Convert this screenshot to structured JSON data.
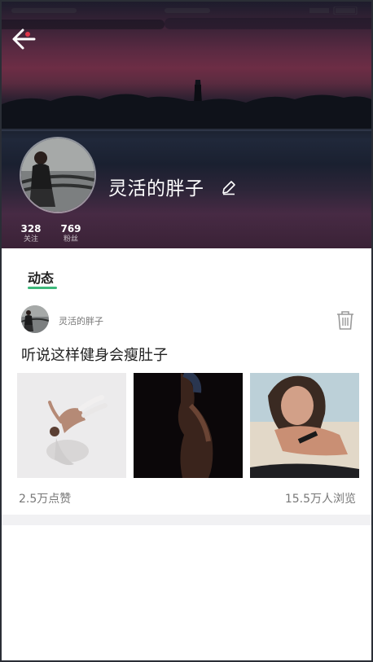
{
  "header": {
    "back_icon": "arrow-left-icon",
    "username": "灵活的胖子",
    "edit_icon": "pencil-icon",
    "stats": [
      {
        "value": "328",
        "label": "关注"
      },
      {
        "value": "769",
        "label": "粉丝"
      }
    ]
  },
  "tabs": [
    {
      "label": "动态",
      "active": true
    }
  ],
  "post": {
    "author": "灵活的胖子",
    "delete_icon": "trash-icon",
    "text": "听说这样健身会瘦肚子",
    "images": [
      "gymnast-jump-photo",
      "muscular-back-photo",
      "woman-smartwatch-photo"
    ],
    "likes": "2.5万点赞",
    "views": "15.5万人浏览"
  },
  "colors": {
    "accent": "#3cb87a",
    "text_primary": "#222222",
    "text_secondary": "#777777"
  }
}
